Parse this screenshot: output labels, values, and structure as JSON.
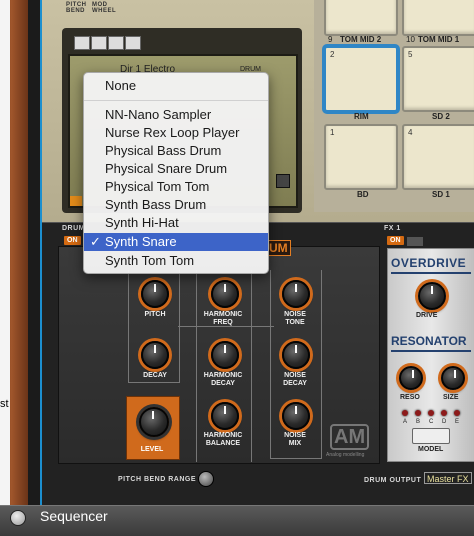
{
  "top_panel": {
    "pitch_bend_label": "PITCH\nBEND",
    "mod_wheel_label": "MOD\nWHEEL",
    "display_text": "Dir 1 Electro",
    "display_right_label": "DRUM"
  },
  "pads": [
    {
      "num": "9",
      "label": "TOM MID 2"
    },
    {
      "num": "10",
      "label": "TOM MID 1"
    },
    {
      "num": "2",
      "label": "RIM"
    },
    {
      "num": "5",
      "label": "SD 2"
    },
    {
      "num": "1",
      "label": "BD"
    },
    {
      "num": "4",
      "label": "SD 1"
    }
  ],
  "menu": {
    "items": [
      "None",
      "NN-Nano Sampler",
      "Nurse Rex Loop Player",
      "Physical Bass Drum",
      "Physical Snare Drum",
      "Physical Tom Tom",
      "Synth Bass Drum",
      "Synth Hi-Hat",
      "Synth Snare",
      "Synth Tom Tom"
    ],
    "selected": "Synth Snare",
    "checkmark": "✓"
  },
  "drum_module": {
    "drum_label": "DRUM",
    "on_label": "ON",
    "title_badge": "UM",
    "knobs": {
      "pitch": "PITCH",
      "harmonic_freq": "HARMONIC\nFREQ",
      "noise_tone": "NOISE\nTONE",
      "decay": "DECAY",
      "harmonic_decay": "HARMONIC\nDECAY",
      "noise_decay": "NOISE\nDECAY",
      "level": "LEVEL",
      "harmonic_balance": "HARMONIC\nBALANCE",
      "noise_mix": "NOISE\nMIX"
    },
    "pitch_bend_range": "PITCH BEND RANGE",
    "drum_output": "DRUM OUTPUT",
    "output_value": "Master FX",
    "logo": "AM",
    "logo_sub": "Analog modelling"
  },
  "fx": {
    "fx_label": "FX 1",
    "on_label": "ON",
    "overdrive_title": "OVERDRIVE",
    "drive_label": "DRIVE",
    "resonator_title": "RESONATOR",
    "reso_label": "RESO",
    "size_label": "SIZE",
    "led_labels": [
      "A",
      "B",
      "C",
      "D",
      "E"
    ],
    "model_label": "MODEL"
  },
  "bottom_bar": {
    "title": "Sequencer"
  },
  "side_text": "st",
  "colors": {
    "accent_orange": "#d06a1c",
    "menu_selected": "#3d64c8",
    "pad_face": "#ece6cc"
  }
}
